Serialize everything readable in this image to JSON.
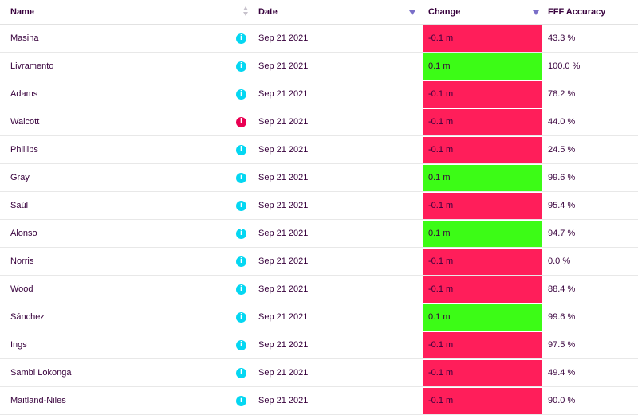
{
  "header": {
    "name": "Name",
    "date": "Date",
    "change": "Change",
    "accuracy": "FFF Accuracy"
  },
  "colors": {
    "negative": "#ff1e5a",
    "positive": "#3cfc16",
    "info_default": "#04d7f2",
    "info_alert": "#e90052"
  },
  "rows": [
    {
      "name": "Masina",
      "info": "i",
      "info_alert": false,
      "date": "Sep 21 2021",
      "change": "-0.1 m",
      "positive": false,
      "accuracy": "43.3 %"
    },
    {
      "name": "Livramento",
      "info": "i",
      "info_alert": false,
      "date": "Sep 21 2021",
      "change": "0.1 m",
      "positive": true,
      "accuracy": "100.0 %"
    },
    {
      "name": "Adams",
      "info": "i",
      "info_alert": false,
      "date": "Sep 21 2021",
      "change": "-0.1 m",
      "positive": false,
      "accuracy": "78.2 %"
    },
    {
      "name": "Walcott",
      "info": "i",
      "info_alert": true,
      "date": "Sep 21 2021",
      "change": "-0.1 m",
      "positive": false,
      "accuracy": "44.0 %"
    },
    {
      "name": "Phillips",
      "info": "i",
      "info_alert": false,
      "date": "Sep 21 2021",
      "change": "-0.1 m",
      "positive": false,
      "accuracy": "24.5 %"
    },
    {
      "name": "Gray",
      "info": "i",
      "info_alert": false,
      "date": "Sep 21 2021",
      "change": "0.1 m",
      "positive": true,
      "accuracy": "99.6 %"
    },
    {
      "name": "Saúl",
      "info": "i",
      "info_alert": false,
      "date": "Sep 21 2021",
      "change": "-0.1 m",
      "positive": false,
      "accuracy": "95.4 %"
    },
    {
      "name": "Alonso",
      "info": "i",
      "info_alert": false,
      "date": "Sep 21 2021",
      "change": "0.1 m",
      "positive": true,
      "accuracy": "94.7 %"
    },
    {
      "name": "Norris",
      "info": "i",
      "info_alert": false,
      "date": "Sep 21 2021",
      "change": "-0.1 m",
      "positive": false,
      "accuracy": "0.0 %"
    },
    {
      "name": "Wood",
      "info": "i",
      "info_alert": false,
      "date": "Sep 21 2021",
      "change": "-0.1 m",
      "positive": false,
      "accuracy": "88.4 %"
    },
    {
      "name": "Sánchez",
      "info": "i",
      "info_alert": false,
      "date": "Sep 21 2021",
      "change": "0.1 m",
      "positive": true,
      "accuracy": "99.6 %"
    },
    {
      "name": "Ings",
      "info": "i",
      "info_alert": false,
      "date": "Sep 21 2021",
      "change": "-0.1 m",
      "positive": false,
      "accuracy": "97.5 %"
    },
    {
      "name": "Sambi Lokonga",
      "info": "i",
      "info_alert": false,
      "date": "Sep 21 2021",
      "change": "-0.1 m",
      "positive": false,
      "accuracy": "49.4 %"
    },
    {
      "name": "Maitland-Niles",
      "info": "i",
      "info_alert": false,
      "date": "Sep 21 2021",
      "change": "-0.1 m",
      "positive": false,
      "accuracy": "90.0 %"
    }
  ]
}
